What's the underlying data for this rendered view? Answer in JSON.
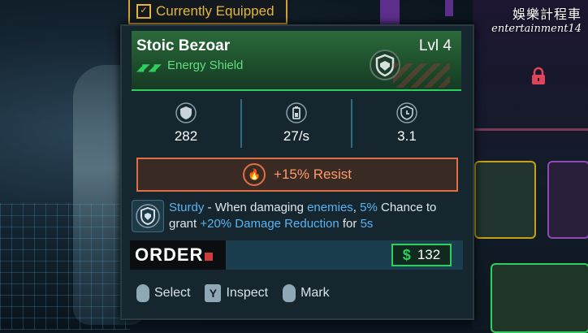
{
  "header": {
    "equipped_label": "Currently Equipped"
  },
  "item": {
    "name": "Stoic Bezoar",
    "level": "Lvl 4",
    "type": "Energy Shield",
    "rarity_color": "#2ecf5e"
  },
  "stats": [
    {
      "icon": "shield-stat-icon",
      "value": "282"
    },
    {
      "icon": "battery-stat-icon",
      "value": "27/s"
    },
    {
      "icon": "timer-stat-icon",
      "value": "3.1"
    }
  ],
  "resist": {
    "icon": "fire-icon",
    "text": "+15% Resist",
    "color": "#e07044"
  },
  "perk": {
    "name": "Sturdy",
    "t1": " - When damaging ",
    "t2": "enemies",
    "t3": ", ",
    "t4": "5%",
    "t5": " Chance to grant ",
    "t6": "+20% Damage Reduction",
    "t7": " for ",
    "t8": "5s"
  },
  "vendor": {
    "brand": "ORDER",
    "currency_symbol": "$",
    "price": "132"
  },
  "controls": [
    {
      "key": "",
      "label": "Select"
    },
    {
      "key": "Y",
      "label": "Inspect"
    },
    {
      "key": "",
      "label": "Mark"
    }
  ],
  "watermark": {
    "line1": "娛樂計程車",
    "line2": "entertainment14"
  }
}
